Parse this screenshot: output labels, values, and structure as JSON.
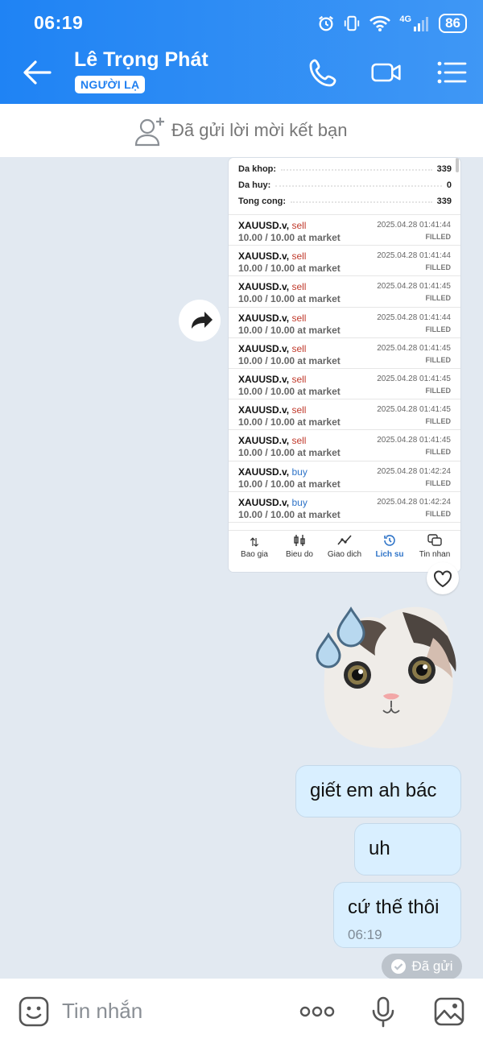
{
  "status_bar": {
    "time": "06:19",
    "network": "4G",
    "battery": "86"
  },
  "header": {
    "name": "Lê Trọng Phát",
    "badge": "NGƯỜI LẠ"
  },
  "friend_request": {
    "text": "Đã gửi lời mời kết bạn"
  },
  "trade_screenshot": {
    "summary": [
      {
        "label": "Da khop:",
        "value": "339"
      },
      {
        "label": "Da huy:",
        "value": "0"
      },
      {
        "label": "Tong cong:",
        "value": "339"
      }
    ],
    "orders": [
      {
        "symbol": "XAUUSD.v,",
        "side": "sell",
        "volume": "10.00 / 10.00 at market",
        "time": "2025.04.28 01:41:44",
        "status": "FILLED"
      },
      {
        "symbol": "XAUUSD.v,",
        "side": "sell",
        "volume": "10.00 / 10.00 at market",
        "time": "2025.04.28 01:41:44",
        "status": "FILLED"
      },
      {
        "symbol": "XAUUSD.v,",
        "side": "sell",
        "volume": "10.00 / 10.00 at market",
        "time": "2025.04.28 01:41:45",
        "status": "FILLED"
      },
      {
        "symbol": "XAUUSD.v,",
        "side": "sell",
        "volume": "10.00 / 10.00 at market",
        "time": "2025.04.28 01:41:44",
        "status": "FILLED"
      },
      {
        "symbol": "XAUUSD.v,",
        "side": "sell",
        "volume": "10.00 / 10.00 at market",
        "time": "2025.04.28 01:41:45",
        "status": "FILLED"
      },
      {
        "symbol": "XAUUSD.v,",
        "side": "sell",
        "volume": "10.00 / 10.00 at market",
        "time": "2025.04.28 01:41:45",
        "status": "FILLED"
      },
      {
        "symbol": "XAUUSD.v,",
        "side": "sell",
        "volume": "10.00 / 10.00 at market",
        "time": "2025.04.28 01:41:45",
        "status": "FILLED"
      },
      {
        "symbol": "XAUUSD.v,",
        "side": "sell",
        "volume": "10.00 / 10.00 at market",
        "time": "2025.04.28 01:41:45",
        "status": "FILLED"
      },
      {
        "symbol": "XAUUSD.v,",
        "side": "buy",
        "volume": "10.00 / 10.00 at market",
        "time": "2025.04.28 01:42:24",
        "status": "FILLED"
      },
      {
        "symbol": "XAUUSD.v,",
        "side": "buy",
        "volume": "10.00 / 10.00 at market",
        "time": "2025.04.28 01:42:24",
        "status": "FILLED"
      }
    ],
    "colors": {
      "sell": "#c0392b",
      "buy": "#2f74c8"
    },
    "nav": [
      {
        "icon": "arrows-updown-icon",
        "label": "Bao gia",
        "active": false
      },
      {
        "icon": "candles-icon",
        "label": "Bieu do",
        "active": false
      },
      {
        "icon": "trend-icon",
        "label": "Giao dich",
        "active": false
      },
      {
        "icon": "history-icon",
        "label": "Lich su",
        "active": true
      },
      {
        "icon": "chat-bubbles-icon",
        "label": "Tin nhan",
        "active": false
      }
    ]
  },
  "messages": [
    {
      "text": "giết em ah bác"
    },
    {
      "text": "uh"
    },
    {
      "text": "cứ thế thôi",
      "time": "06:19"
    }
  ],
  "sent_status": "Đã gửi",
  "composer": {
    "placeholder": "Tin nhắn"
  },
  "colors": {
    "header": "#1f83f4",
    "bubble": "#d9efff",
    "background": "#e2e9f1"
  }
}
